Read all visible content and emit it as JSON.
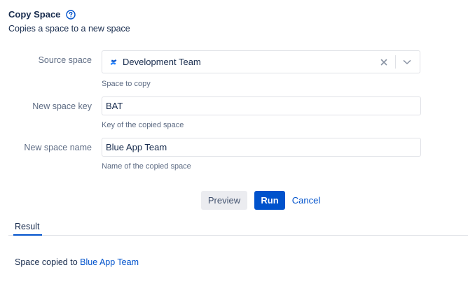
{
  "header": {
    "title": "Copy Space",
    "help_icon": "question-circle-icon",
    "subtitle": "Copies a space to a new space"
  },
  "form": {
    "source_space": {
      "label": "Source space",
      "value": "Development Team",
      "space_icon": "confluence-space-icon",
      "clear_icon": "close-icon",
      "dropdown_icon": "chevron-down-icon",
      "helper": "Space to copy"
    },
    "new_space_key": {
      "label": "New space key",
      "value": "BAT",
      "helper": "Key of the copied space"
    },
    "new_space_name": {
      "label": "New space name",
      "value": "Blue App Team",
      "helper": "Name of the copied space"
    }
  },
  "actions": {
    "preview_label": "Preview",
    "run_label": "Run",
    "cancel_label": "Cancel"
  },
  "result": {
    "tab_label": "Result",
    "message_prefix": "Space copied to",
    "link_text": "Blue App Team"
  },
  "colors": {
    "primary": "#0052cc",
    "text": "#172b4d",
    "subtle_text": "#5e6c84",
    "border": "#dfe1e6",
    "button_neutral_bg": "#ebecf0"
  }
}
